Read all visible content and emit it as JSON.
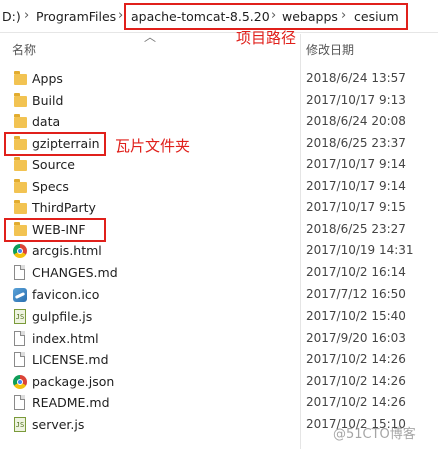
{
  "breadcrumb": {
    "drive_fragment": "D:)",
    "segments": [
      "ProgramFiles",
      "apache-tomcat-8.5.20",
      "webapps",
      "cesium"
    ],
    "separator": "›"
  },
  "annotations": {
    "project_path": "项目路径",
    "tile_folder": "瓦片文件夹"
  },
  "columns": {
    "name": "名称",
    "modified": "修改日期"
  },
  "files": [
    {
      "name": "Apps",
      "date": "2018/6/24 13:57",
      "icon": "folder-icon"
    },
    {
      "name": "Build",
      "date": "2017/10/17 9:13",
      "icon": "folder-icon"
    },
    {
      "name": "data",
      "date": "2018/6/24 20:08",
      "icon": "folder-icon"
    },
    {
      "name": "gzipterrain",
      "date": "2018/6/25 23:37",
      "icon": "folder-icon"
    },
    {
      "name": "Source",
      "date": "2017/10/17 9:14",
      "icon": "folder-icon"
    },
    {
      "name": "Specs",
      "date": "2017/10/17 9:14",
      "icon": "folder-icon"
    },
    {
      "name": "ThirdParty",
      "date": "2017/10/17 9:15",
      "icon": "folder-icon"
    },
    {
      "name": "WEB-INF",
      "date": "2018/6/25 23:27",
      "icon": "folder-icon"
    },
    {
      "name": "arcgis.html",
      "date": "2017/10/19 14:31",
      "icon": "chrome-icon"
    },
    {
      "name": "CHANGES.md",
      "date": "2017/10/2 16:14",
      "icon": "text-file-icon"
    },
    {
      "name": "favicon.ico",
      "date": "2017/7/12 16:50",
      "icon": "image-icon"
    },
    {
      "name": "gulpfile.js",
      "date": "2017/10/2 15:40",
      "icon": "js-file-icon"
    },
    {
      "name": "index.html",
      "date": "2017/9/20 16:03",
      "icon": "text-file-icon"
    },
    {
      "name": "LICENSE.md",
      "date": "2017/10/2 14:26",
      "icon": "text-file-icon"
    },
    {
      "name": "package.json",
      "date": "2017/10/2 14:26",
      "icon": "chrome-icon"
    },
    {
      "name": "README.md",
      "date": "2017/10/2 14:26",
      "icon": "text-file-icon"
    },
    {
      "name": "server.js",
      "date": "2017/10/2 15:10",
      "icon": "js-file-icon"
    }
  ],
  "watermark": "@51CTO博客",
  "colors": {
    "highlight": "#e0201b",
    "folder": "#f2c352"
  }
}
